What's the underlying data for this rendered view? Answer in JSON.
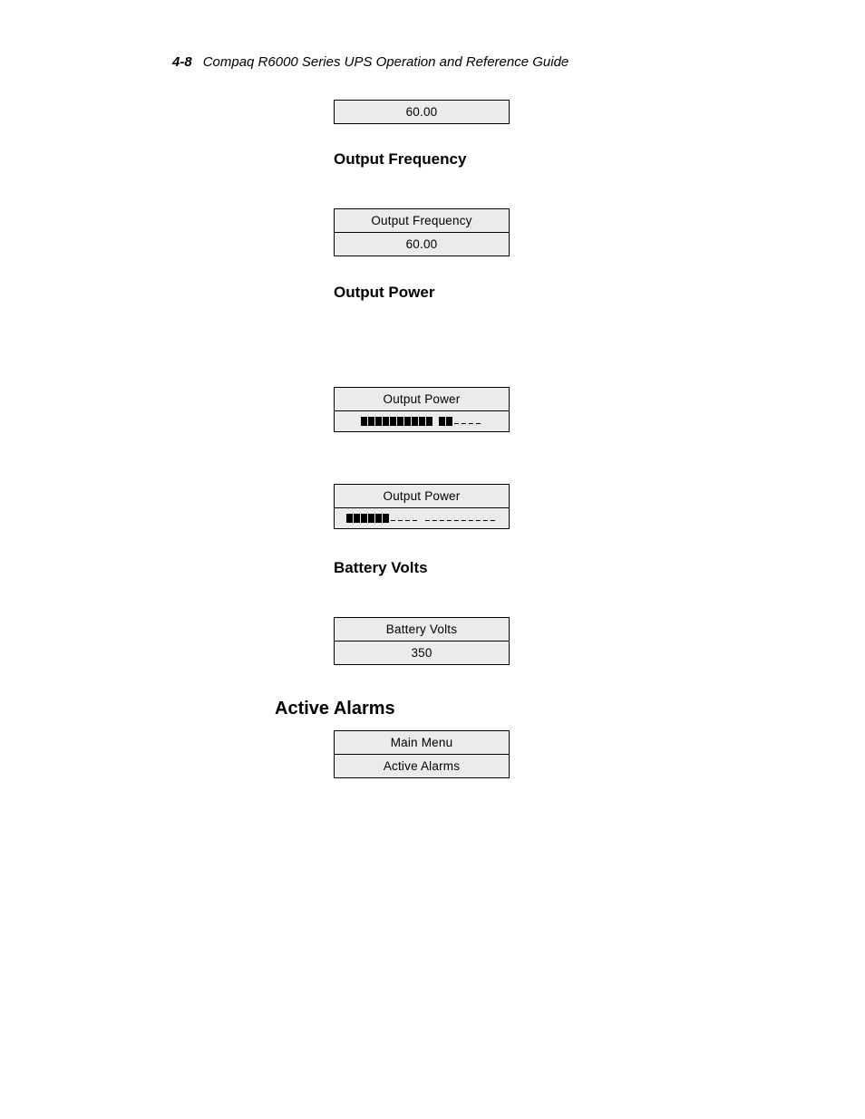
{
  "header": {
    "page_number": "4-8",
    "title": "Compaq R6000 Series UPS Operation and Reference Guide"
  },
  "box1": {
    "row1": "60.00"
  },
  "sub1": "Output Frequency",
  "box2": {
    "row1": "Output Frequency",
    "row2": "60.00"
  },
  "sub2": "Output Power",
  "box3": {
    "row1": "Output Power"
  },
  "box4": {
    "row1": "Output Power"
  },
  "sub3": "Battery Volts",
  "box5": {
    "row1": "Battery Volts",
    "row2": "350"
  },
  "heading1": "Active Alarms",
  "box6": {
    "row1": "Main Menu",
    "row2": "Active Alarms"
  }
}
